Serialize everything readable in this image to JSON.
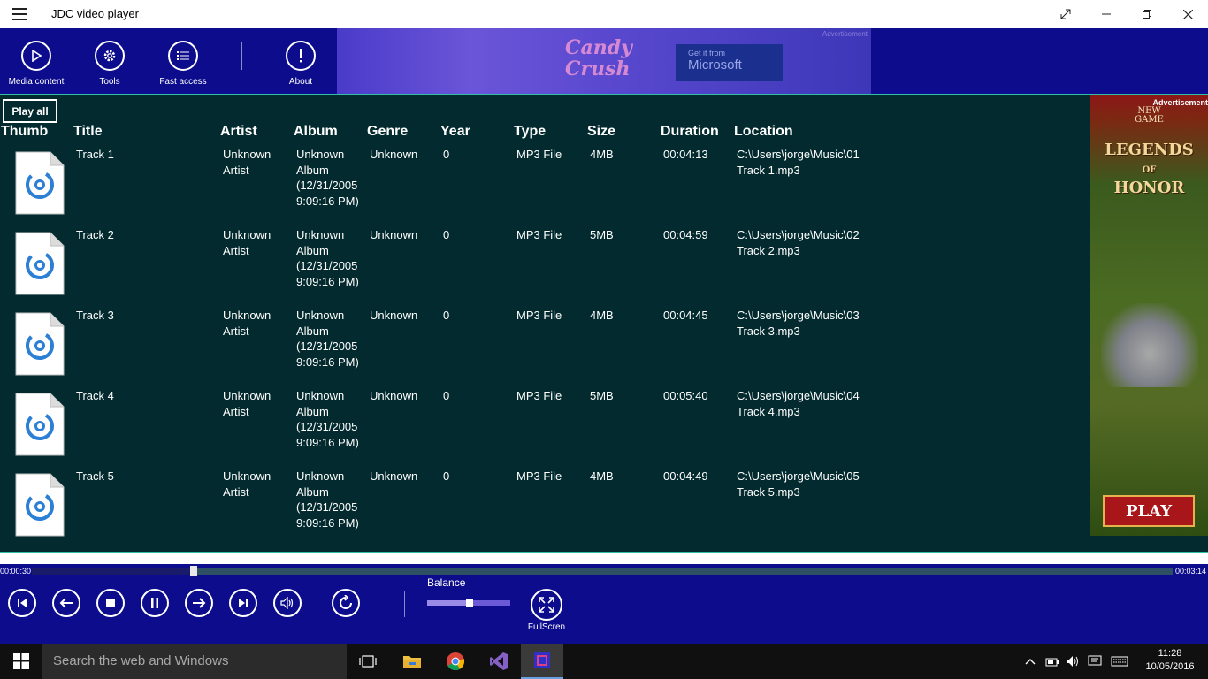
{
  "window": {
    "title": "JDC video player"
  },
  "toolbar": [
    {
      "label": "Media content",
      "icon": "play-icon"
    },
    {
      "label": "Tools",
      "icon": "gear-icon"
    },
    {
      "label": "Fast access",
      "icon": "list-icon"
    },
    {
      "label": "About",
      "icon": "exclamation-icon"
    }
  ],
  "top_ad": {
    "brand": "Candy Crush",
    "store_small": "Get it from",
    "store_big": "Microsoft",
    "tag": "Advertisement"
  },
  "play_all_label": "Play all",
  "columns": [
    "Thumb",
    "Title",
    "Artist",
    "Album",
    "Genre",
    "Year",
    "Type",
    "Size",
    "Duration",
    "Location"
  ],
  "tracks": [
    {
      "title": "Track 1",
      "artist": "Unknown Artist",
      "album": "Unknown Album (12/31/2005 9:09:16 PM)",
      "genre": "Unknown",
      "year": "0",
      "type": "MP3 File",
      "size": "4MB",
      "duration": "00:04:13",
      "location": "C:\\Users\\jorge\\Music\\01 Track 1.mp3"
    },
    {
      "title": "Track 2",
      "artist": "Unknown Artist",
      "album": "Unknown Album (12/31/2005 9:09:16 PM)",
      "genre": "Unknown",
      "year": "0",
      "type": "MP3 File",
      "size": "5MB",
      "duration": "00:04:59",
      "location": "C:\\Users\\jorge\\Music\\02 Track 2.mp3"
    },
    {
      "title": "Track 3",
      "artist": "Unknown Artist",
      "album": "Unknown Album (12/31/2005 9:09:16 PM)",
      "genre": "Unknown",
      "year": "0",
      "type": "MP3 File",
      "size": "4MB",
      "duration": "00:04:45",
      "location": "C:\\Users\\jorge\\Music\\03 Track 3.mp3"
    },
    {
      "title": "Track 4",
      "artist": "Unknown Artist",
      "album": "Unknown Album (12/31/2005 9:09:16 PM)",
      "genre": "Unknown",
      "year": "0",
      "type": "MP3 File",
      "size": "5MB",
      "duration": "00:05:40",
      "location": "C:\\Users\\jorge\\Music\\04 Track 4.mp3"
    },
    {
      "title": "Track 5",
      "artist": "Unknown Artist",
      "album": "Unknown Album (12/31/2005 9:09:16 PM)",
      "genre": "Unknown",
      "year": "0",
      "type": "MP3 File",
      "size": "4MB",
      "duration": "00:04:49",
      "location": "C:\\Users\\jorge\\Music\\05 Track 5.mp3"
    }
  ],
  "side_ad": {
    "tag": "Advertisement",
    "badge": "NEW GAME",
    "logo": "LEGENDS OF HONOR",
    "play_label": "PLAY"
  },
  "playback": {
    "elapsed": "00:00:30",
    "total": "00:03:14",
    "progress_fraction": 0.14
  },
  "controls": {
    "balance_label": "Balance",
    "balance_fraction": 0.5,
    "fullscreen_label": "FullScren"
  },
  "taskbar": {
    "search_placeholder": "Search the web and Windows",
    "time": "11:28",
    "date": "10/05/2016"
  },
  "colors": {
    "toolbar_bg": "#0c0c8c",
    "list_bg": "#032a2e",
    "accent": "#2fbfa6"
  }
}
